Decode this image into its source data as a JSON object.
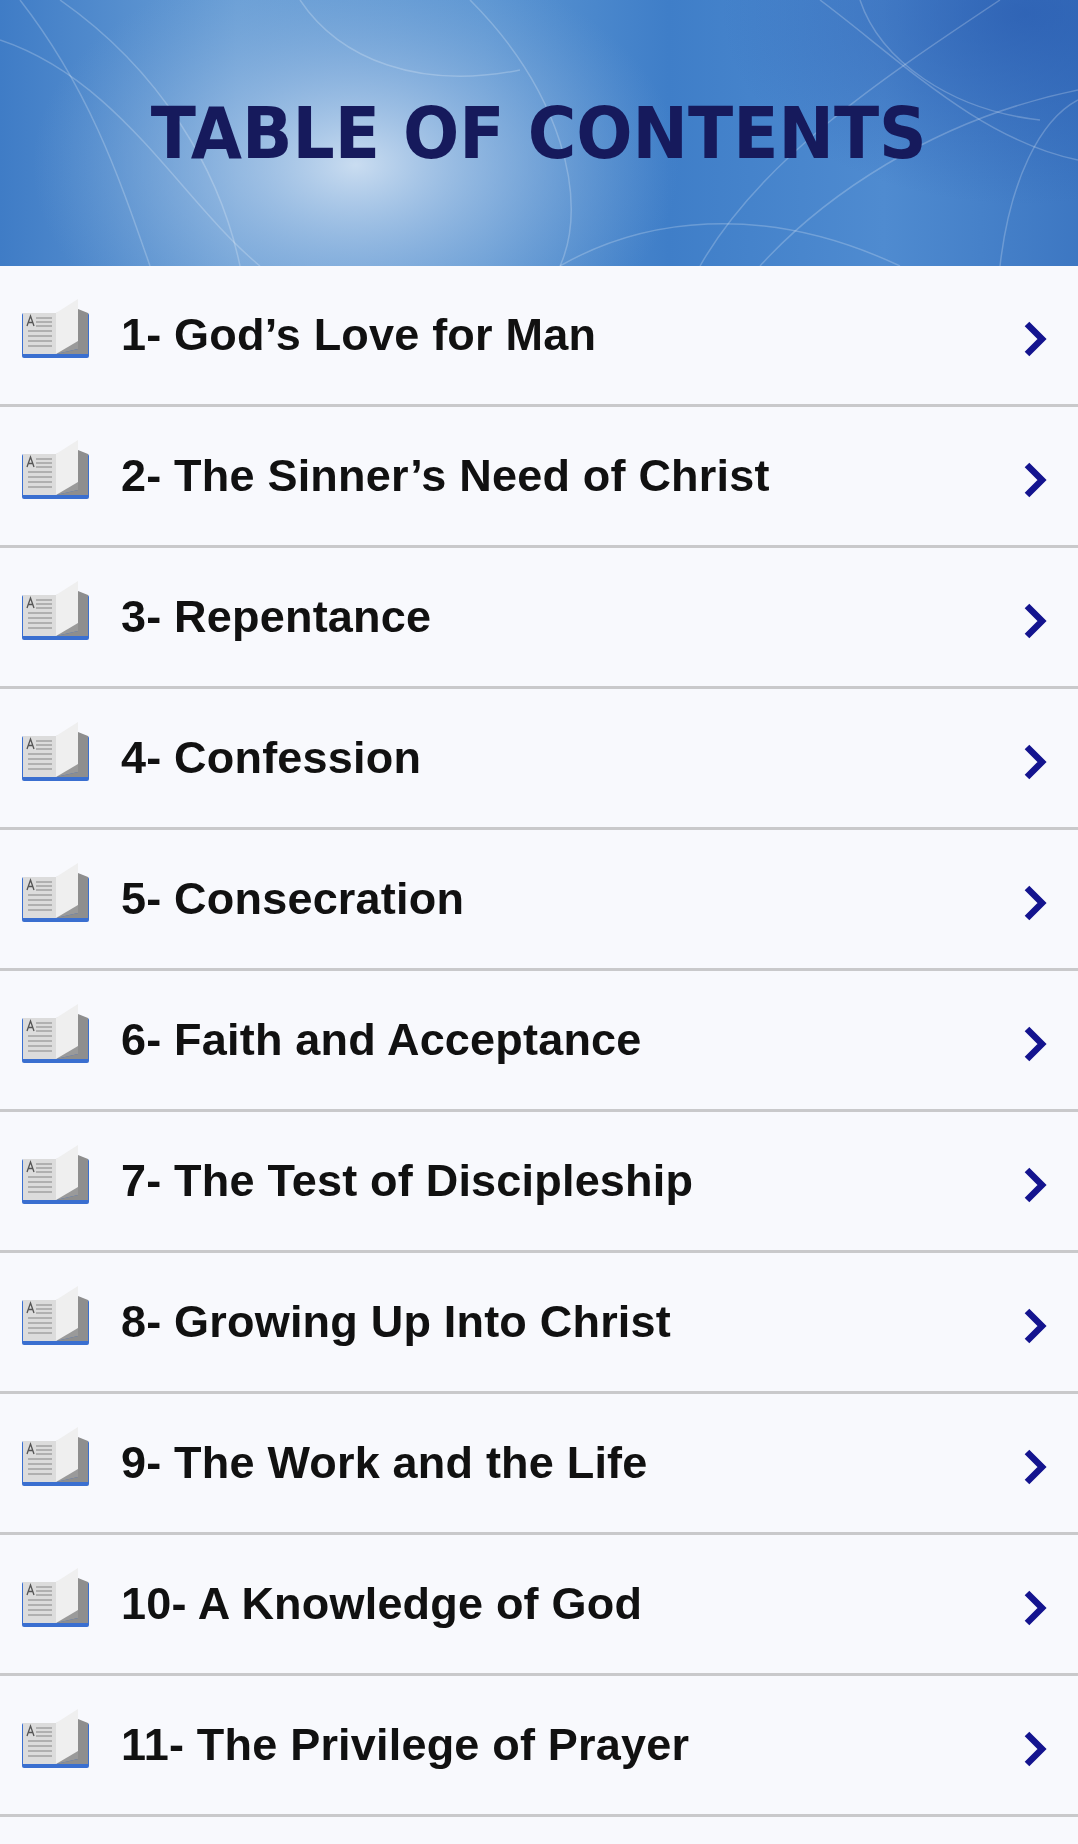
{
  "header": {
    "title": "TABLE OF CONTENTS"
  },
  "chapters": [
    {
      "title": "1- God’s Love for Man"
    },
    {
      "title": "2- The Sinner’s Need of Christ"
    },
    {
      "title": "3- Repentance"
    },
    {
      "title": "4- Confession"
    },
    {
      "title": "5- Consecration"
    },
    {
      "title": "6- Faith and Acceptance"
    },
    {
      "title": "7- The Test of Discipleship"
    },
    {
      "title": "8- Growing Up Into Christ"
    },
    {
      "title": "9- The Work and the Life"
    },
    {
      "title": "10- A Knowledge of God"
    },
    {
      "title": "11- The Privilege of Prayer"
    }
  ]
}
